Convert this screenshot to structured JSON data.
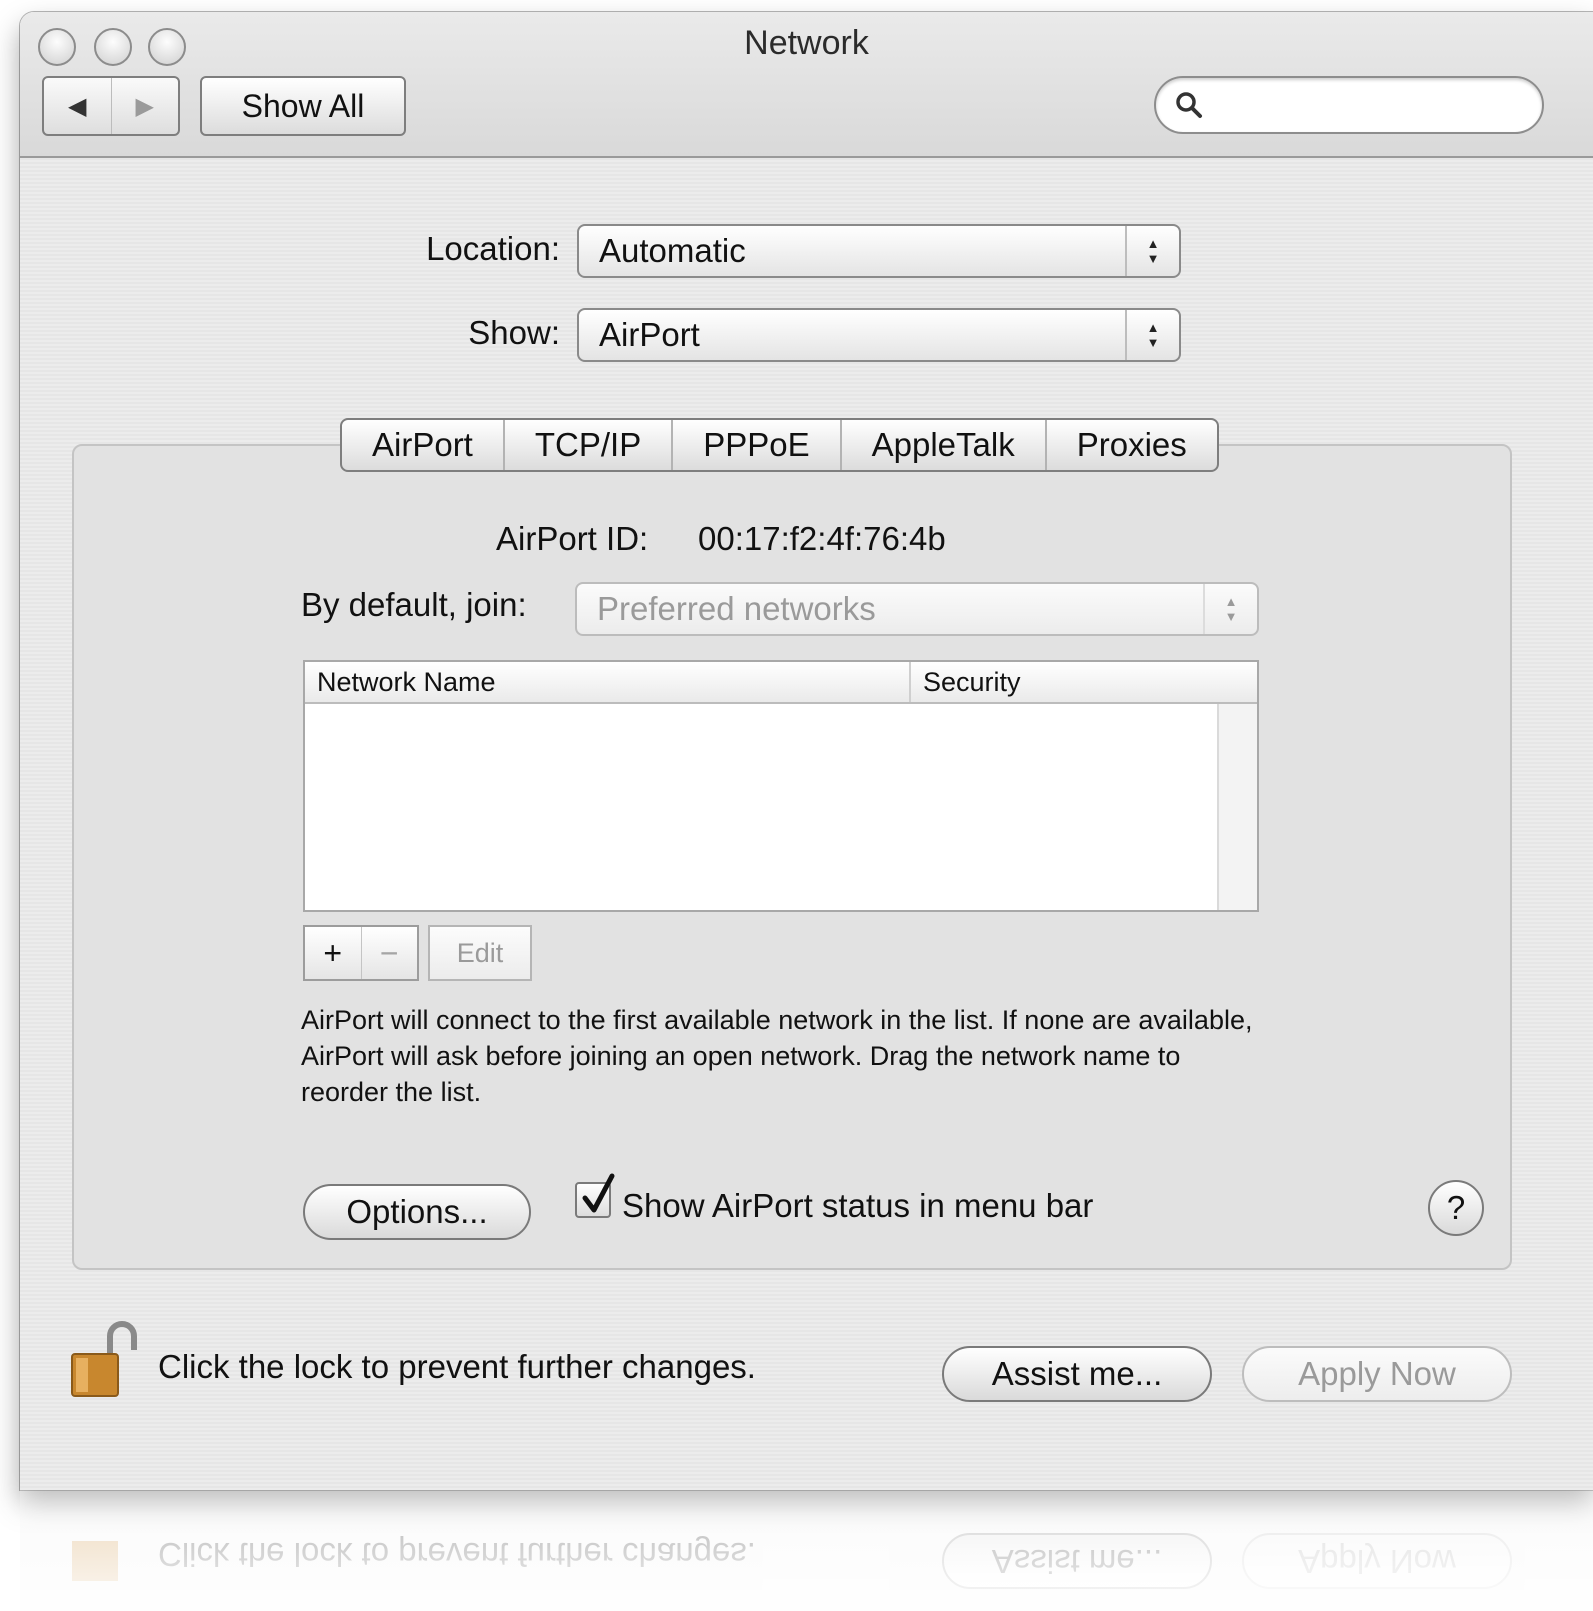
{
  "window": {
    "title": "Network",
    "traffic_lights": [
      "close",
      "minimize",
      "zoom"
    ]
  },
  "toolbar": {
    "back_icon": "triangle-left-icon",
    "forward_icon": "triangle-right-icon",
    "show_all_label": "Show All",
    "search": {
      "value": "",
      "placeholder": "",
      "icon": "magnifier-icon"
    }
  },
  "location": {
    "label": "Location:",
    "value": "Automatic"
  },
  "show": {
    "label": "Show:",
    "value": "AirPort"
  },
  "tabs": [
    {
      "label": "AirPort",
      "selected": true
    },
    {
      "label": "TCP/IP",
      "selected": false
    },
    {
      "label": "PPPoE",
      "selected": false
    },
    {
      "label": "AppleTalk",
      "selected": false
    },
    {
      "label": "Proxies",
      "selected": false
    }
  ],
  "airport": {
    "id_label": "AirPort ID:",
    "id_value": "00:17:f2:4f:76:4b",
    "join_label": "By default, join:",
    "join_value": "Preferred networks",
    "table": {
      "columns": [
        "Network Name",
        "Security"
      ],
      "rows": []
    },
    "add_label": "+",
    "remove_label": "−",
    "edit_label": "Edit",
    "description": "AirPort will connect to the first available network in the list. If none are available, AirPort will ask before joining an open network. Drag the network name to reorder the list.",
    "options_label": "Options...",
    "status_checkbox": {
      "label": "Show AirPort status in menu bar",
      "checked": true
    },
    "help_label": "?"
  },
  "footer": {
    "lock_text": "Click the lock to prevent further changes.",
    "assist_label": "Assist me...",
    "apply_label": "Apply Now",
    "lock_icon": "padlock-open-icon"
  }
}
